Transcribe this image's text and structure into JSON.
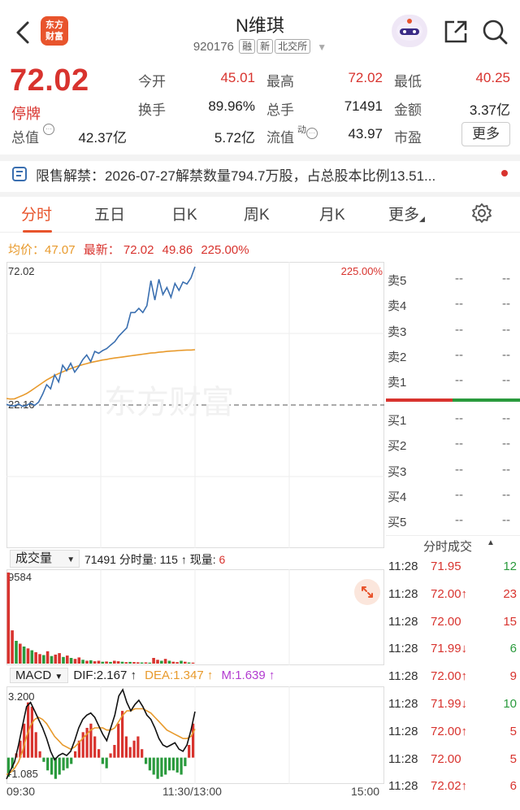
{
  "header": {
    "stock_name": "N维琪",
    "stock_code": "920176",
    "tags": [
      "融",
      "新",
      "北交所"
    ],
    "logo_text_1": "东方",
    "logo_text_2": "财富"
  },
  "quote": {
    "price": "72.02",
    "status": "停牌",
    "fields": [
      {
        "label": "今开",
        "value": "45.01",
        "color": "red"
      },
      {
        "label": "最高",
        "value": "72.02",
        "color": "red"
      },
      {
        "label": "最低",
        "value": "40.25",
        "color": "red"
      },
      {
        "label": "换手",
        "value": "89.96%",
        "color": "normal"
      },
      {
        "label": "总手",
        "value": "71491",
        "color": "normal"
      },
      {
        "label": "金额",
        "value": "3.37亿",
        "color": "normal"
      },
      {
        "label": "总值",
        "value": "42.37亿",
        "color": "normal"
      },
      {
        "label": "流值",
        "value": "5.72亿",
        "color": "normal"
      },
      {
        "label": "市盈",
        "value": "43.97",
        "color": "normal"
      }
    ],
    "pe_sup": "动",
    "more_label": "更多"
  },
  "notice": {
    "text": "限售解禁：2026-07-27解禁数量794.7万股，占总股本比例13.51..."
  },
  "tabs": [
    "分时",
    "五日",
    "日K",
    "周K",
    "月K",
    "更多"
  ],
  "intraday": {
    "avg_label": "均价：47.07",
    "latest_label": "最新：",
    "latest_price": "72.02",
    "change": "49.86",
    "change_pct": "225.00%",
    "y_top_label": "72.02",
    "y_top_pct": "225.00%",
    "prev_close_label": "22.16",
    "watermark": "东方财富",
    "price_series": [
      22.4,
      21.9,
      21.8,
      22.5,
      21.7,
      22.0,
      22.8,
      22.0,
      23.2,
      26.0,
      29.5,
      28.0,
      33.0,
      30.5,
      36.5,
      34.5,
      37.2,
      34.0,
      36.0,
      38.5,
      40.2,
      37.8,
      41.5,
      40.8,
      41.8,
      42.5,
      43.8,
      45.0,
      47.0,
      48.5,
      50.0,
      55.5,
      55.5,
      57.0,
      55.5,
      58.0,
      67.0,
      60.0,
      67.5,
      62.0,
      64.5,
      61.0,
      66.0,
      63.5,
      66.5,
      65.8,
      68.0,
      72.02
    ],
    "avg_series": [
      24.5,
      24.3,
      24.4,
      25.0,
      25.6,
      26.3,
      27.2,
      28.2,
      29.2,
      30.2,
      31.2,
      32.0,
      32.8,
      33.5,
      34.1,
      34.7,
      35.3,
      35.8,
      36.3,
      36.7,
      37.1,
      37.5,
      37.8,
      38.1,
      38.4,
      38.6,
      38.9,
      39.1,
      39.3,
      39.5,
      39.7,
      39.9,
      40.1,
      40.3,
      40.5,
      40.7,
      40.9,
      41.0,
      41.2,
      41.3,
      41.5,
      41.6,
      41.7,
      41.8,
      41.9,
      42.0,
      42.0,
      42.1
    ],
    "y_min": 22.16,
    "y_max": 72.02
  },
  "volume": {
    "selector_label": "成交量",
    "total": "71491",
    "per_min_label": "分时量: 115 ↑",
    "current_label": "现量:",
    "current_value": "6",
    "y_label": "9584",
    "max": 9584,
    "bars": [
      9584,
      3500,
      2400,
      2100,
      1800,
      1600,
      1400,
      1200,
      1000,
      900,
      1300,
      800,
      950,
      1100,
      700,
      850,
      600,
      500,
      650,
      400,
      300,
      350,
      250,
      300,
      200,
      220,
      180,
      300,
      250,
      200,
      150,
      180,
      160,
      140,
      120,
      130,
      100,
      600,
      400,
      300,
      500,
      300,
      200,
      150,
      300,
      200,
      120,
      100
    ],
    "bar_colors": [
      "red",
      "red",
      "green",
      "red",
      "green",
      "red",
      "green",
      "red",
      "red",
      "green",
      "red",
      "green",
      "red",
      "red",
      "green",
      "red",
      "green",
      "red",
      "red",
      "green",
      "red",
      "green",
      "red",
      "red",
      "green",
      "red",
      "green",
      "red",
      "red",
      "green",
      "red",
      "green",
      "red",
      "red",
      "green",
      "red",
      "green",
      "red",
      "red",
      "green",
      "red",
      "green",
      "red",
      "red",
      "green",
      "red",
      "green",
      "red"
    ]
  },
  "macd": {
    "label": "MACD",
    "dif_label": "DIF:2.167 ↑",
    "dea_label": "DEA:1.347 ↑",
    "m_label": "M:1.639 ↑",
    "y_top": "3.200",
    "y_bottom": "-1.085",
    "y_max": 3.2,
    "y_min": -1.085,
    "dif": [
      -1.0,
      -0.6,
      -0.2,
      0.6,
      1.5,
      2.4,
      2.6,
      2.2,
      1.8,
      1.4,
      0.9,
      0.3,
      -0.1,
      0.1,
      0.2,
      0.1,
      0.3,
      0.8,
      1.4,
      1.8,
      2.0,
      2.1,
      1.9,
      1.5,
      1.1,
      0.8,
      1.4,
      2.0,
      2.9,
      3.2,
      2.6,
      2.2,
      2.5,
      2.7,
      2.4,
      2.0,
      1.8,
      1.4,
      0.9,
      0.6,
      0.5,
      0.6,
      0.7,
      0.4,
      0.3,
      0.6,
      1.3,
      2.167
    ],
    "dea": [
      -0.8,
      -0.7,
      -0.5,
      -0.2,
      0.3,
      1.0,
      1.5,
      1.8,
      1.9,
      1.8,
      1.6,
      1.3,
      1.0,
      0.8,
      0.6,
      0.5,
      0.4,
      0.5,
      0.7,
      0.9,
      1.1,
      1.3,
      1.4,
      1.4,
      1.4,
      1.3,
      1.3,
      1.4,
      1.7,
      2.0,
      2.2,
      2.2,
      2.3,
      2.3,
      2.3,
      2.2,
      2.1,
      1.9,
      1.7,
      1.5,
      1.3,
      1.2,
      1.1,
      1.0,
      0.9,
      0.9,
      1.0,
      1.347
    ],
    "hist": [
      -0.9,
      -0.5,
      0.2,
      0.8,
      1.6,
      2.6,
      2.4,
      1.2,
      0.3,
      -0.2,
      -0.6,
      -0.8,
      -1.0,
      -0.8,
      -0.6,
      -0.5,
      -0.3,
      0.3,
      0.8,
      1.2,
      1.4,
      1.6,
      1.0,
      0.4,
      -0.3,
      -0.5,
      0.2,
      0.6,
      1.6,
      2.2,
      1.0,
      0.5,
      0.8,
      1.0,
      0.4,
      -0.3,
      -0.6,
      -0.8,
      -1.0,
      -0.9,
      -0.8,
      -0.6,
      -0.6,
      -0.7,
      -0.8,
      -0.4,
      0.6,
      1.6
    ]
  },
  "time_axis": {
    "start": "09:30",
    "mid": "11:30/13:00",
    "end": "15:00"
  },
  "order_book": {
    "asks": [
      {
        "label": "卖5",
        "price": "--",
        "vol": "--"
      },
      {
        "label": "卖4",
        "price": "--",
        "vol": "--"
      },
      {
        "label": "卖3",
        "price": "--",
        "vol": "--"
      },
      {
        "label": "卖2",
        "price": "--",
        "vol": "--"
      },
      {
        "label": "卖1",
        "price": "--",
        "vol": "--"
      }
    ],
    "bids": [
      {
        "label": "买1",
        "price": "--",
        "vol": "--"
      },
      {
        "label": "买2",
        "price": "--",
        "vol": "--"
      },
      {
        "label": "买3",
        "price": "--",
        "vol": "--"
      },
      {
        "label": "买4",
        "price": "--",
        "vol": "--"
      },
      {
        "label": "买5",
        "price": "--",
        "vol": "--"
      }
    ]
  },
  "trades": {
    "header": "分时成交",
    "rows": [
      {
        "time": "11:28",
        "price": "71.95",
        "vol": "12",
        "vol_color": "green",
        "price_color": "red"
      },
      {
        "time": "11:28",
        "price": "72.00↑",
        "vol": "23",
        "vol_color": "red",
        "price_color": "red"
      },
      {
        "time": "11:28",
        "price": "72.00",
        "vol": "15",
        "vol_color": "red",
        "price_color": "red"
      },
      {
        "time": "11:28",
        "price": "71.99↓",
        "vol": "6",
        "vol_color": "green",
        "price_color": "red"
      },
      {
        "time": "11:28",
        "price": "72.00↑",
        "vol": "9",
        "vol_color": "red",
        "price_color": "red"
      },
      {
        "time": "11:28",
        "price": "71.99↓",
        "vol": "10",
        "vol_color": "green",
        "price_color": "red"
      },
      {
        "time": "11:28",
        "price": "72.00↑",
        "vol": "5",
        "vol_color": "red",
        "price_color": "red"
      },
      {
        "time": "11:28",
        "price": "72.00",
        "vol": "5",
        "vol_color": "red",
        "price_color": "red"
      },
      {
        "time": "11:28",
        "price": "72.02↑",
        "vol": "6",
        "vol_color": "red",
        "price_color": "red"
      }
    ]
  },
  "colors": {
    "red": "#d8332e",
    "green": "#2a9a3d",
    "orange": "#e8542c",
    "blue": "#3a6fb0",
    "avg": "#e89a2c",
    "purple": "#b23bd0"
  }
}
